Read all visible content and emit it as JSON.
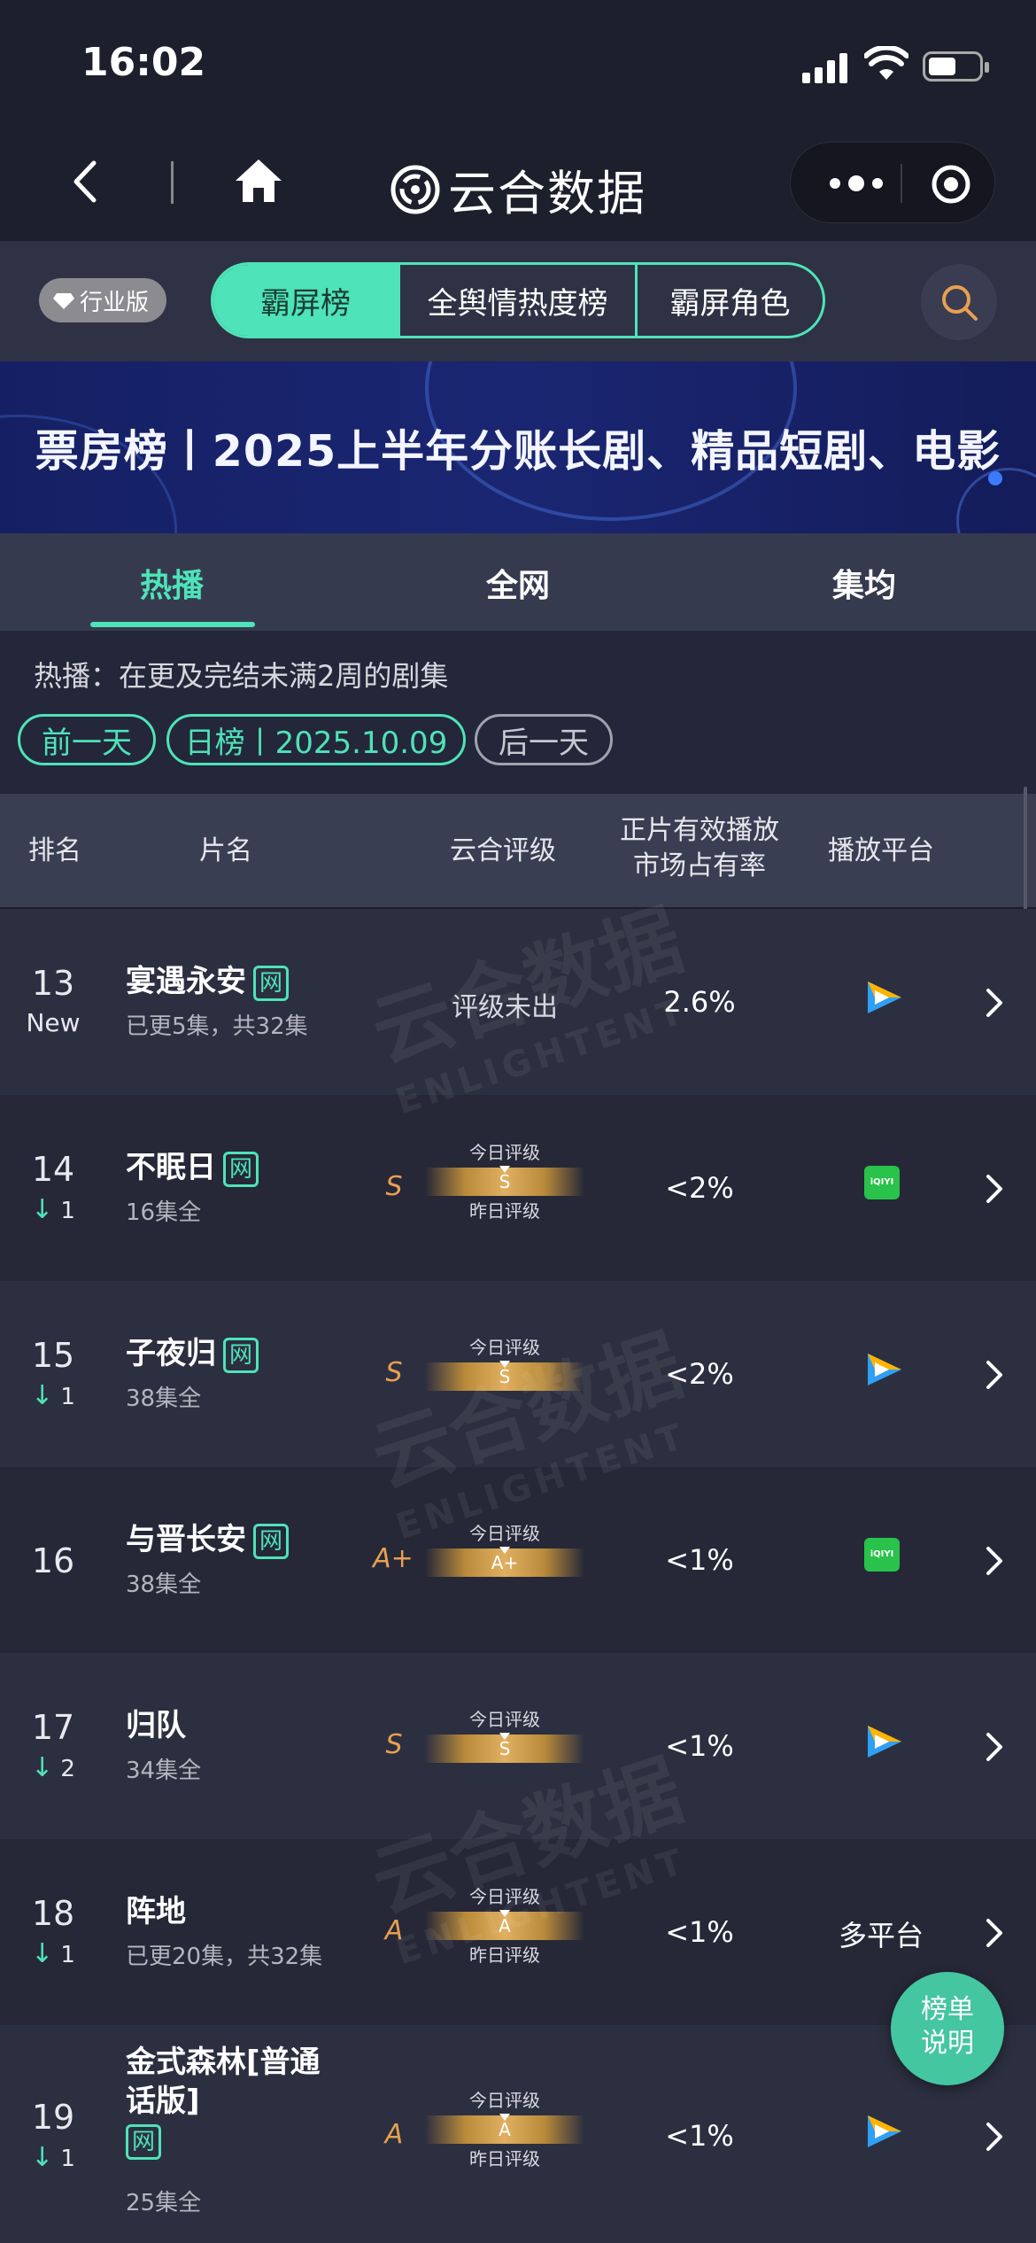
{
  "status_bar": {
    "time": "16:02"
  },
  "nav": {
    "app_name": "云合数据"
  },
  "filter": {
    "edition_badge": "行业版",
    "segments": [
      "霸屏榜",
      "全舆情热度榜",
      "霸屏角色"
    ]
  },
  "banner": {
    "text": "票房榜丨2025上半年分账长剧、精品短剧、电影"
  },
  "tabs": [
    "热播",
    "全网",
    "集均"
  ],
  "description": "热播：在更及完结未满2周的剧集",
  "date_nav": {
    "prev": "前一天",
    "current": "日榜丨2025.10.09",
    "next": "后一天"
  },
  "table": {
    "headers": [
      "排名",
      "片名",
      "云合评级",
      "正片有效播放",
      "市场占有率",
      "播放平台"
    ],
    "grade_today_label": "今日评级",
    "grade_yesterday_label": "昨日评级",
    "rows": [
      {
        "rank": "13",
        "change": "New",
        "title": "宴遇永安",
        "wang": "网",
        "episodes": "已更5集，共32集",
        "grade": "",
        "prev_grade": "",
        "no_grade": "评级未出",
        "share": "2.6%",
        "platform": "tencent-video",
        "platform_text": ""
      },
      {
        "rank": "14",
        "change": "1",
        "title": "不眠日",
        "wang": "网",
        "episodes": "16集全",
        "grade": "S",
        "prev_grade": "S",
        "no_grade": "",
        "share": "<2%",
        "platform": "iqiyi",
        "platform_text": ""
      },
      {
        "rank": "15",
        "change": "1",
        "title": "子夜归",
        "wang": "网",
        "episodes": "38集全",
        "grade": "S",
        "prev_grade": "S",
        "no_grade": "",
        "share": "<2%",
        "platform": "tencent-video",
        "platform_text": ""
      },
      {
        "rank": "16",
        "change": "",
        "title": "与晋长安",
        "wang": "网",
        "episodes": "38集全",
        "grade": "A+",
        "prev_grade": "A+",
        "no_grade": "",
        "share": "<1%",
        "platform": "iqiyi",
        "platform_text": ""
      },
      {
        "rank": "17",
        "change": "2",
        "title": "归队",
        "wang": "",
        "episodes": "34集全",
        "grade": "S",
        "prev_grade": "S",
        "no_grade": "",
        "share": "<1%",
        "platform": "tencent-video",
        "platform_text": ""
      },
      {
        "rank": "18",
        "change": "1",
        "title": "阵地",
        "wang": "",
        "episodes": "已更20集，共32集",
        "grade": "A",
        "prev_grade": "A",
        "no_grade": "",
        "share": "<1%",
        "platform": "multi",
        "platform_text": "多平台"
      },
      {
        "rank": "19",
        "change": "1",
        "title_line1": "金式森林[普通",
        "title_line2": "话版]",
        "wang": "网",
        "episodes": "25集全",
        "grade": "A",
        "prev_grade": "A",
        "no_grade": "",
        "share": "<1%",
        "platform": "tencent-video",
        "platform_text": ""
      }
    ]
  },
  "iqiyi_logo_text": "iQIYI",
  "watermark": {
    "cn": "云合数据",
    "en": "ENLIGHTENT"
  },
  "fab": {
    "line1": "榜单",
    "line2": "说明"
  },
  "colors": {
    "accent": "#4ee3b8",
    "grade": "#e8a050",
    "background": "#24273a"
  }
}
